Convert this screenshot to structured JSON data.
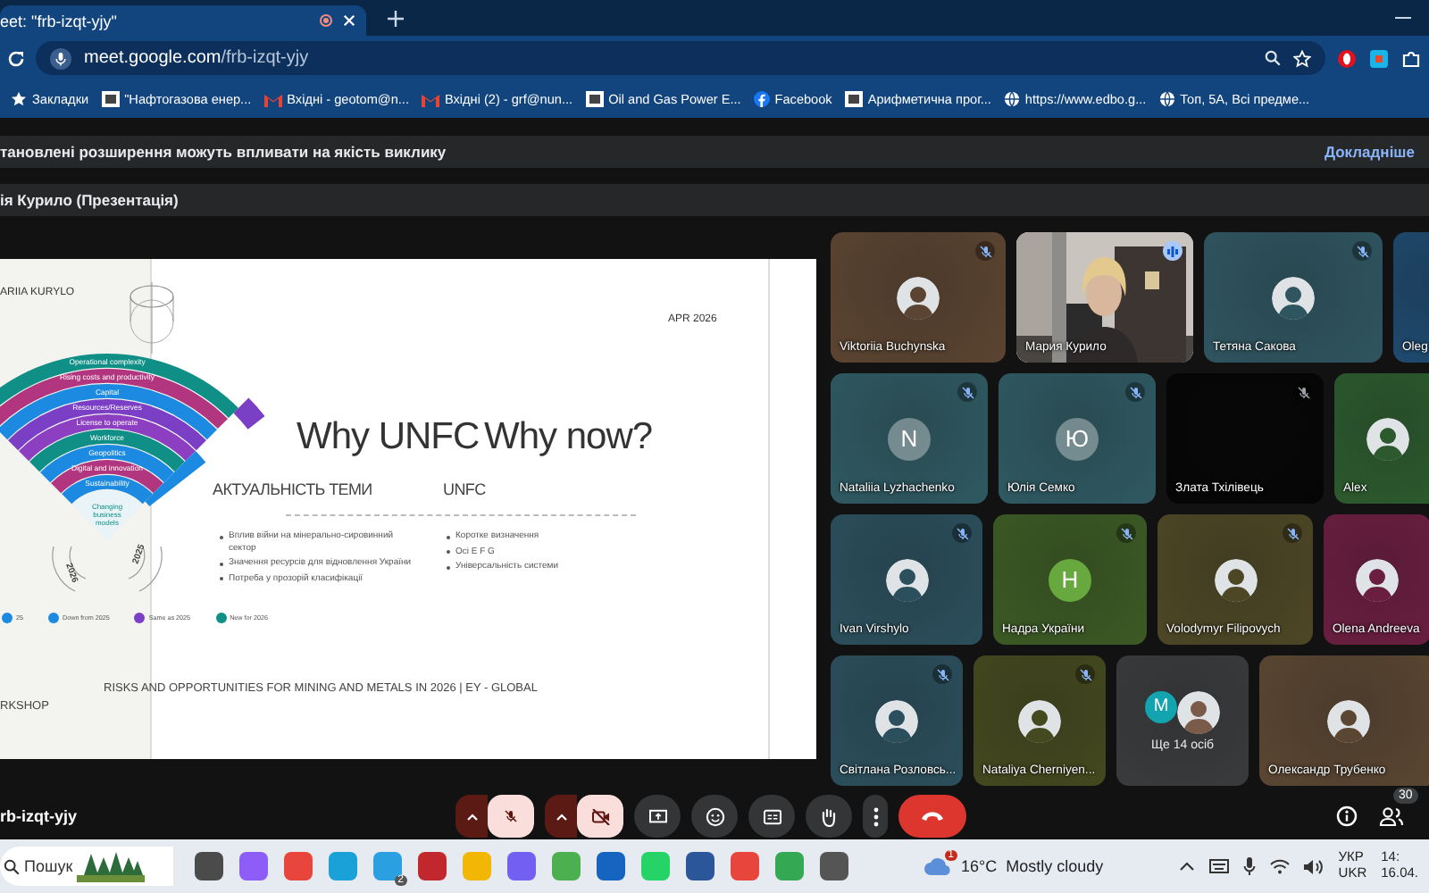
{
  "browser": {
    "tab": {
      "title": "eet: \"frb-izqt-yjy\"",
      "recording": true
    },
    "url_host": "meet.google.com",
    "url_path": "/frb-izqt-yjy",
    "bookmarks": [
      {
        "label": "Закладки",
        "kind": "star"
      },
      {
        "label": "\"Нафтогазова енер...",
        "kind": "logo"
      },
      {
        "label": "Вхідні - geotom@n...",
        "kind": "mail"
      },
      {
        "label": "Вхідні (2) - grf@nun...",
        "kind": "mail"
      },
      {
        "label": "Oil and Gas Power E...",
        "kind": "logo"
      },
      {
        "label": "Facebook",
        "kind": "facebook"
      },
      {
        "label": "Арифметична прог...",
        "kind": "logo"
      },
      {
        "label": "https://www.edbo.g...",
        "kind": "globe"
      },
      {
        "label": "Топ, 5А, Всі предме...",
        "kind": "globe"
      }
    ]
  },
  "banner": {
    "text": "тановлені розширення можуть впливати на якість виклику",
    "link": "Докладніше"
  },
  "presentation_title": "ія Курило (Презентація)",
  "slide": {
    "author": "ARIIA KURYLO",
    "date": "APR 2026",
    "title_left": "Why UNFC",
    "title_right": "Why now?",
    "subhead_left": "АКТУАЛЬНІСТЬ ТЕМИ",
    "subhead_right": "UNFC",
    "bullets_left": [
      "Вплив війни на мінерально-сировинний сектор",
      "Значення ресурсів для відновлення України",
      "Потреба у прозорій класифікації"
    ],
    "bullets_right": [
      "Коротке визначення",
      "Осі E F G",
      "Універсальність системи"
    ],
    "source": "RISKS AND OPPORTUNITIES FOR MINING AND METALS IN 2026 | EY - GLOBAL",
    "footer_left": "RKSHOP",
    "fan": {
      "bands": [
        {
          "label": "Operational complexity",
          "color": "#0f8f86"
        },
        {
          "label": "Rising costs and productivity",
          "color": "#b2367f"
        },
        {
          "label": "Capital",
          "color": "#1c8ae0"
        },
        {
          "label": "Resources/Reserves",
          "color": "#7b3fc6"
        },
        {
          "label": "License to operate",
          "color": "#8c3fc0"
        },
        {
          "label": "Workforce",
          "color": "#0f8f86"
        },
        {
          "label": "Geopolitics",
          "color": "#1c8ae0"
        },
        {
          "label": "Digital and innovation",
          "color": "#b2367f"
        },
        {
          "label": "Sustainability",
          "color": "#1c8ae0"
        }
      ],
      "center_label": "Changing business models",
      "years": [
        "2026",
        "2025"
      ],
      "legend": [
        {
          "label": "25",
          "color": "#1c8ae0"
        },
        {
          "label": "Down from 2025",
          "color": "#1c8ae0"
        },
        {
          "label": "Same as 2025",
          "color": "#7b3fc6"
        },
        {
          "label": "New for 2026",
          "color": "#0f8f86"
        }
      ]
    }
  },
  "participants": [
    {
      "name": "Viktoriia Buchynska",
      "color": "#5b4431",
      "muted": true,
      "speaking": false
    },
    {
      "name": "Мария Курило",
      "kind": "video",
      "color": "#3a3a3a",
      "muted": false,
      "speaking": true
    },
    {
      "name": "Тетяна Сакова",
      "color": "#2f5560",
      "muted": true,
      "speaking": false
    },
    {
      "name": "Oleg",
      "kind": "none",
      "color": "#1f4a6e",
      "muted": false,
      "speaking": false
    },
    {
      "name": "Nataliia Lyzhachenko",
      "kind": "initial",
      "initial": "N",
      "color": "#2f5962",
      "muted": true,
      "speaking": false
    },
    {
      "name": "Юлія Семко",
      "kind": "initial",
      "initial": "Ю",
      "color": "#2f5962",
      "muted": true,
      "speaking": false
    },
    {
      "name": "Злата Тхілівець",
      "kind": "none",
      "color": "#050505",
      "muted": true,
      "speaking": false
    },
    {
      "name": "Alex",
      "color": "#2c5a2e",
      "muted": false,
      "speaking": false
    },
    {
      "name": "Ivan Virshylo",
      "color": "#2b4f5c",
      "muted": true,
      "speaking": false
    },
    {
      "name": "Надра України",
      "kind": "initial",
      "initial": "H",
      "color": "#3c5a24",
      "muted": true,
      "speaking": false
    },
    {
      "name": "Volodymyr Filipovych",
      "color": "#4d4726",
      "muted": true,
      "speaking": false
    },
    {
      "name": "Olena Andreeva",
      "color": "#6a1e40",
      "muted": false,
      "speaking": false
    },
    {
      "name": "Світлана Розловсь...",
      "color": "#2b4f5c",
      "muted": true,
      "speaking": false
    },
    {
      "name": "Nataliya Cherniyen...",
      "color": "#44491f",
      "muted": true,
      "speaking": false
    },
    {
      "name": "Ще 14 осіб",
      "kind": "group",
      "initial": "M",
      "color": "#3a3b3d",
      "muted": false,
      "speaking": false
    },
    {
      "name": "Олександр Трубенко",
      "color": "#5a4632",
      "muted": false,
      "speaking": false
    }
  ],
  "meeting_code": "rb-izqt-yjy",
  "controls": {
    "mic_on": false,
    "camera_on": false,
    "people_count": "30"
  },
  "taskbar": {
    "search": "Пошук",
    "app_badge": "2",
    "weather_badge": "1",
    "temperature": "16°C",
    "weather_text": "Mostly cloudy",
    "language_top": "УКР",
    "language_bottom": "UKR",
    "time": "14:",
    "date": "16.04."
  }
}
